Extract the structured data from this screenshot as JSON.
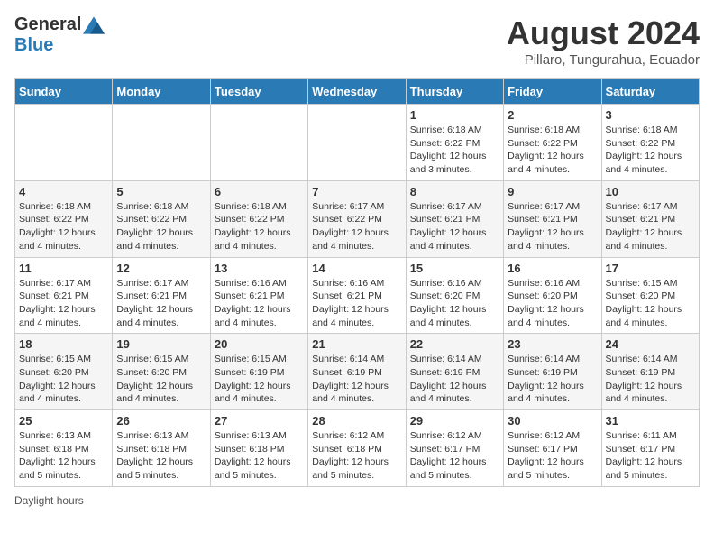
{
  "logo": {
    "general": "General",
    "blue": "Blue"
  },
  "header": {
    "month": "August 2024",
    "location": "Pillaro, Tungurahua, Ecuador"
  },
  "days_of_week": [
    "Sunday",
    "Monday",
    "Tuesday",
    "Wednesday",
    "Thursday",
    "Friday",
    "Saturday"
  ],
  "weeks": [
    [
      {
        "day": "",
        "info": ""
      },
      {
        "day": "",
        "info": ""
      },
      {
        "day": "",
        "info": ""
      },
      {
        "day": "",
        "info": ""
      },
      {
        "day": "1",
        "info": "Sunrise: 6:18 AM\nSunset: 6:22 PM\nDaylight: 12 hours and 3 minutes."
      },
      {
        "day": "2",
        "info": "Sunrise: 6:18 AM\nSunset: 6:22 PM\nDaylight: 12 hours and 4 minutes."
      },
      {
        "day": "3",
        "info": "Sunrise: 6:18 AM\nSunset: 6:22 PM\nDaylight: 12 hours and 4 minutes."
      }
    ],
    [
      {
        "day": "4",
        "info": "Sunrise: 6:18 AM\nSunset: 6:22 PM\nDaylight: 12 hours and 4 minutes."
      },
      {
        "day": "5",
        "info": "Sunrise: 6:18 AM\nSunset: 6:22 PM\nDaylight: 12 hours and 4 minutes."
      },
      {
        "day": "6",
        "info": "Sunrise: 6:18 AM\nSunset: 6:22 PM\nDaylight: 12 hours and 4 minutes."
      },
      {
        "day": "7",
        "info": "Sunrise: 6:17 AM\nSunset: 6:22 PM\nDaylight: 12 hours and 4 minutes."
      },
      {
        "day": "8",
        "info": "Sunrise: 6:17 AM\nSunset: 6:21 PM\nDaylight: 12 hours and 4 minutes."
      },
      {
        "day": "9",
        "info": "Sunrise: 6:17 AM\nSunset: 6:21 PM\nDaylight: 12 hours and 4 minutes."
      },
      {
        "day": "10",
        "info": "Sunrise: 6:17 AM\nSunset: 6:21 PM\nDaylight: 12 hours and 4 minutes."
      }
    ],
    [
      {
        "day": "11",
        "info": "Sunrise: 6:17 AM\nSunset: 6:21 PM\nDaylight: 12 hours and 4 minutes."
      },
      {
        "day": "12",
        "info": "Sunrise: 6:17 AM\nSunset: 6:21 PM\nDaylight: 12 hours and 4 minutes."
      },
      {
        "day": "13",
        "info": "Sunrise: 6:16 AM\nSunset: 6:21 PM\nDaylight: 12 hours and 4 minutes."
      },
      {
        "day": "14",
        "info": "Sunrise: 6:16 AM\nSunset: 6:21 PM\nDaylight: 12 hours and 4 minutes."
      },
      {
        "day": "15",
        "info": "Sunrise: 6:16 AM\nSunset: 6:20 PM\nDaylight: 12 hours and 4 minutes."
      },
      {
        "day": "16",
        "info": "Sunrise: 6:16 AM\nSunset: 6:20 PM\nDaylight: 12 hours and 4 minutes."
      },
      {
        "day": "17",
        "info": "Sunrise: 6:15 AM\nSunset: 6:20 PM\nDaylight: 12 hours and 4 minutes."
      }
    ],
    [
      {
        "day": "18",
        "info": "Sunrise: 6:15 AM\nSunset: 6:20 PM\nDaylight: 12 hours and 4 minutes."
      },
      {
        "day": "19",
        "info": "Sunrise: 6:15 AM\nSunset: 6:20 PM\nDaylight: 12 hours and 4 minutes."
      },
      {
        "day": "20",
        "info": "Sunrise: 6:15 AM\nSunset: 6:19 PM\nDaylight: 12 hours and 4 minutes."
      },
      {
        "day": "21",
        "info": "Sunrise: 6:14 AM\nSunset: 6:19 PM\nDaylight: 12 hours and 4 minutes."
      },
      {
        "day": "22",
        "info": "Sunrise: 6:14 AM\nSunset: 6:19 PM\nDaylight: 12 hours and 4 minutes."
      },
      {
        "day": "23",
        "info": "Sunrise: 6:14 AM\nSunset: 6:19 PM\nDaylight: 12 hours and 4 minutes."
      },
      {
        "day": "24",
        "info": "Sunrise: 6:14 AM\nSunset: 6:19 PM\nDaylight: 12 hours and 4 minutes."
      }
    ],
    [
      {
        "day": "25",
        "info": "Sunrise: 6:13 AM\nSunset: 6:18 PM\nDaylight: 12 hours and 5 minutes."
      },
      {
        "day": "26",
        "info": "Sunrise: 6:13 AM\nSunset: 6:18 PM\nDaylight: 12 hours and 5 minutes."
      },
      {
        "day": "27",
        "info": "Sunrise: 6:13 AM\nSunset: 6:18 PM\nDaylight: 12 hours and 5 minutes."
      },
      {
        "day": "28",
        "info": "Sunrise: 6:12 AM\nSunset: 6:18 PM\nDaylight: 12 hours and 5 minutes."
      },
      {
        "day": "29",
        "info": "Sunrise: 6:12 AM\nSunset: 6:17 PM\nDaylight: 12 hours and 5 minutes."
      },
      {
        "day": "30",
        "info": "Sunrise: 6:12 AM\nSunset: 6:17 PM\nDaylight: 12 hours and 5 minutes."
      },
      {
        "day": "31",
        "info": "Sunrise: 6:11 AM\nSunset: 6:17 PM\nDaylight: 12 hours and 5 minutes."
      }
    ]
  ],
  "footer": {
    "note": "Daylight hours"
  }
}
